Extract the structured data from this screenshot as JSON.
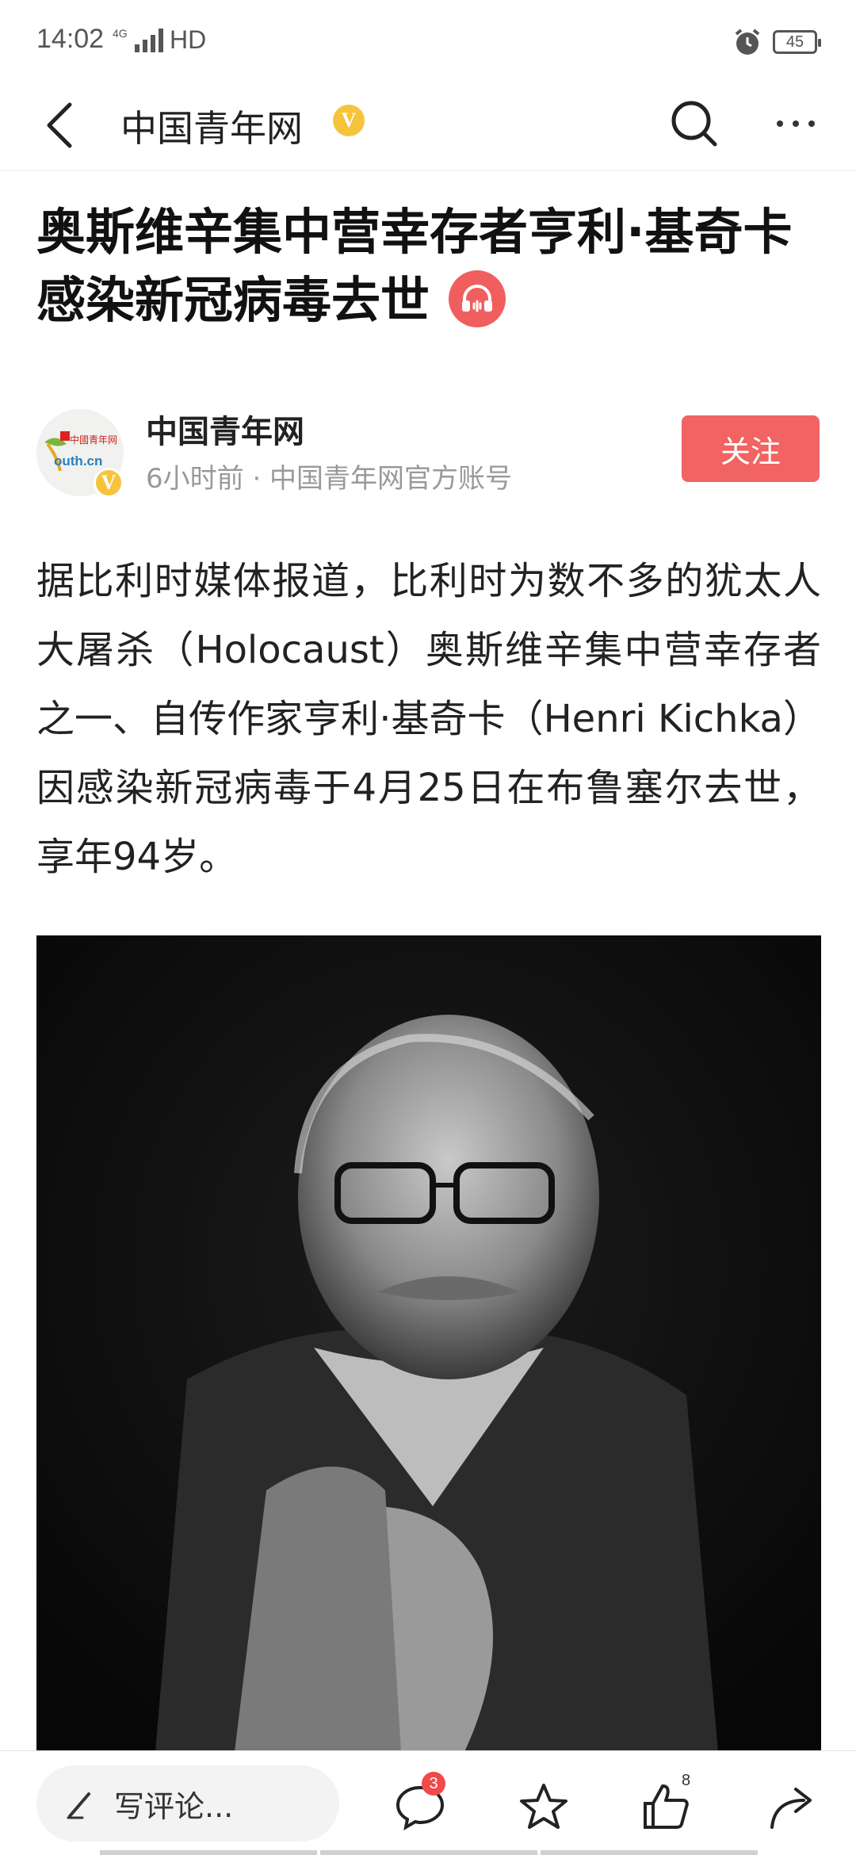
{
  "status_bar": {
    "time": "14:02",
    "network": "4G",
    "hd": "HD",
    "battery": "45"
  },
  "nav": {
    "title": "中国青年网",
    "verified_mark": "V"
  },
  "article": {
    "headline": "奥斯维辛集中营幸存者亨利·基奇卡感染新冠病毒去世",
    "author": {
      "name": "中国青年网",
      "avatar_text_top": "中國青年网",
      "avatar_text_mark": "outh.cn",
      "meta": "6小时前 · 中国青年网官方账号",
      "verified_mark": "V"
    },
    "follow_label": "关注",
    "paragraph": "据比利时媒体报道，比利时为数不多的犹太人大屠杀（Holocaust）奥斯维辛集中营幸存者之一、自传作家亨利·基奇卡（Henri Kichka）因感染新冠病毒于4月25日在布鲁塞尔去世，享年94岁。"
  },
  "toolbar": {
    "comment_placeholder": "写评论...",
    "comment_count": "3",
    "like_count": "8"
  },
  "colors": {
    "accent": "#f26363",
    "verified": "#f6c43c",
    "photo_bg": "#0c0c0c"
  },
  "icons": [
    "back-arrow-icon",
    "search-icon",
    "more-icon",
    "headphones-icon",
    "pen-icon",
    "comment-icon",
    "star-icon",
    "thumbs-up-icon",
    "share-icon",
    "alarm-icon"
  ]
}
